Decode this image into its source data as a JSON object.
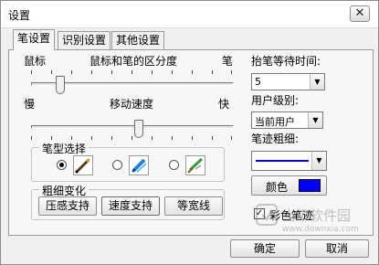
{
  "window": {
    "title": "设置",
    "close_glyph": "✕"
  },
  "tabs": [
    {
      "label": "笔设置",
      "active": true
    },
    {
      "label": "识别设置",
      "active": false
    },
    {
      "label": "其他设置",
      "active": false
    }
  ],
  "pen_distinction": {
    "left_label": "鼠标",
    "center_label": "鼠标和笔的区分度",
    "right_label": "笔"
  },
  "move_speed": {
    "left_label": "慢",
    "center_label": "移动速度",
    "right_label": "快"
  },
  "pen_type": {
    "title": "笔型选择",
    "options": [
      {
        "icon": "fountain-pen-icon",
        "selected": true
      },
      {
        "icon": "marker-pen-icon",
        "selected": false
      },
      {
        "icon": "brush-pen-icon",
        "selected": false
      }
    ]
  },
  "thickness_change": {
    "title": "粗细变化",
    "buttons": [
      "压感支持",
      "速度支持",
      "等宽线"
    ]
  },
  "right_panel": {
    "wait_time_label": "抬笔等待时间:",
    "wait_time_value": "5",
    "user_level_label": "用户级别:",
    "user_level_value": "当前用户",
    "thickness_label": "笔迹粗细:",
    "color_label": "颜色",
    "color_value": "#0000ff",
    "colored_ink_label": "彩色笔迹",
    "colored_ink_checked": true
  },
  "footer": {
    "ok_label": "确定",
    "cancel_label": "取消"
  },
  "watermark": {
    "line1": "当下软件园",
    "line2": "www.downxia.com"
  }
}
